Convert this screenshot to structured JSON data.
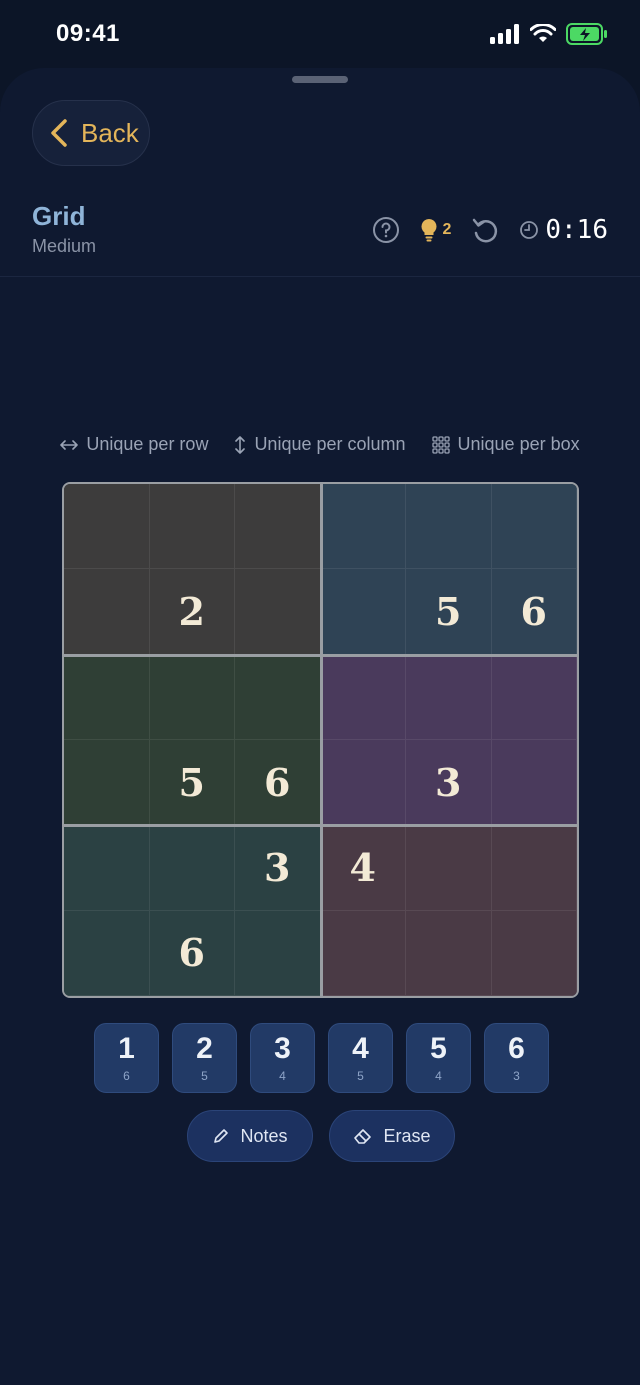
{
  "status": {
    "time": "09:41"
  },
  "nav": {
    "back_label": "Back"
  },
  "game": {
    "title": "Grid",
    "difficulty": "Medium"
  },
  "toolbar": {
    "hints": "2",
    "timer": "0:16"
  },
  "rules": [
    {
      "icon": "horizontal-arrows-icon",
      "label": "Unique per row"
    },
    {
      "icon": "vertical-arrows-icon",
      "label": "Unique per column"
    },
    {
      "icon": "grid-dots-icon",
      "label": "Unique per box"
    }
  ],
  "board": {
    "size": 6,
    "rows": [
      [
        "",
        "",
        "",
        "",
        "",
        ""
      ],
      [
        "",
        "2",
        "",
        "",
        "5",
        "6"
      ],
      [
        "",
        "",
        "",
        "",
        "",
        ""
      ],
      [
        "",
        "5",
        "6",
        "",
        "3",
        ""
      ],
      [
        "",
        "",
        "3",
        "4",
        "",
        ""
      ],
      [
        "",
        "6",
        "",
        "",
        "",
        ""
      ]
    ],
    "box_colors": {
      "box-a": "#3d3c3c",
      "box-b": "#2f4355",
      "box-c": "#2f3f35",
      "box-d": "#4a3a5c",
      "box-e": "#2b4143",
      "box-f": "#4a3a45"
    }
  },
  "numpad": [
    {
      "digit": "1",
      "remaining": "6"
    },
    {
      "digit": "2",
      "remaining": "5"
    },
    {
      "digit": "3",
      "remaining": "4"
    },
    {
      "digit": "4",
      "remaining": "5"
    },
    {
      "digit": "5",
      "remaining": "4"
    },
    {
      "digit": "6",
      "remaining": "3"
    }
  ],
  "actions": {
    "notes_label": "Notes",
    "erase_label": "Erase"
  },
  "colors": {
    "accent": "#e3b55a",
    "title": "#8fb4d8",
    "key": "#223a66"
  }
}
